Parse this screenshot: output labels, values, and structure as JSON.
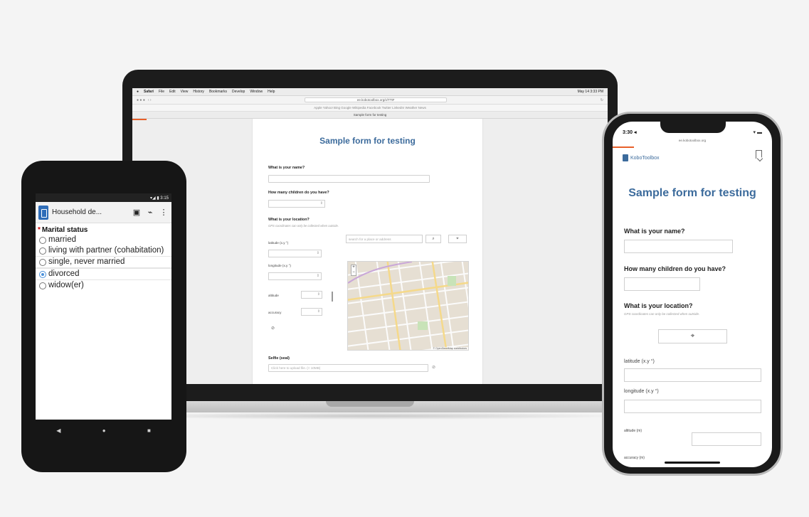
{
  "laptop": {
    "menubar": {
      "apple": "",
      "items": [
        "Safari",
        "File",
        "Edit",
        "View",
        "History",
        "Bookmarks",
        "Develop",
        "Window",
        "Help"
      ],
      "clock": "May 14 3:33 PM"
    },
    "browser": {
      "url": "ee.kobotoolbox.org/x/TTtF",
      "bookmarks": "Apple  Yahoo!  Bing  Google  Wikipedia  Facebook  Twitter  LinkedIn  Weather  News",
      "tab_title": "Sample form for testing"
    },
    "form": {
      "title": "Sample form for testing",
      "q_name": "What is your name?",
      "q_children": "How many children do you have?",
      "q_location": "What is your location?",
      "location_hint": "GPS coordinates can only be collected when outside.",
      "latitude_label": "latitude (x.y °)",
      "longitude_label": "longitude (x.y °)",
      "altitude_label": "altitude",
      "accuracy_label": "accuracy",
      "search_placeholder": "search for a place or address",
      "search_icon": "⌕",
      "locate_icon": "⌖",
      "map_attribution": "© OpenStreetMap contributors",
      "selfie_label": "Selfie (seal)",
      "selfie_placeholder": "Click here to upload file. (< 10MB)"
    }
  },
  "android": {
    "status": "▾◢ ▮ 3:15",
    "app_title": "Household de...",
    "save_icon": "▣",
    "gps_icon": "⌁",
    "more_icon": "⋮",
    "question": "Marital status",
    "required_mark": "*",
    "options": [
      {
        "label": "married",
        "selected": false
      },
      {
        "label": "living with partner (cohabitation)",
        "selected": false
      },
      {
        "label": "single, never married",
        "selected": false
      },
      {
        "label": "divorced",
        "selected": true
      },
      {
        "label": "widow(er)",
        "selected": false
      }
    ],
    "nav": {
      "back": "◀",
      "home": "●",
      "recents": "■"
    }
  },
  "iphone": {
    "time": "3:30 ◂",
    "battery": "▾ ▬",
    "url": "ee.kobotoolbox.org",
    "logo_text": "KoboToolbox",
    "form": {
      "title": "Sample form for testing",
      "q_name": "What is your name?",
      "q_children": "How many children do you have?",
      "q_location": "What is your location?",
      "location_hint": "GPS coordinates can only be collected when outside.",
      "locate_icon": "⌖",
      "latitude_label": "latitude (x.y °)",
      "longitude_label": "longitude (x.y °)",
      "altitude_label": "altitude (m)",
      "accuracy_label": "accuracy (m)"
    }
  }
}
